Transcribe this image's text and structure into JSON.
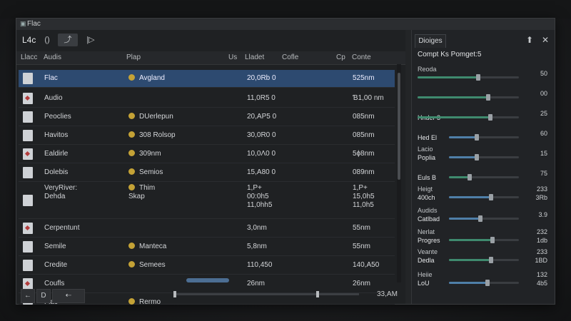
{
  "window": {
    "title": "Flac"
  },
  "toolbar": {
    "label": "L4c",
    "icon1": "()",
    "icon2": "⤴",
    "icon3": "|▷"
  },
  "columns": [
    "Llacc",
    "Audis",
    "Plap",
    "Us",
    "Lladet",
    "Cofle",
    "Cp",
    "Conte"
  ],
  "rows": [
    {
      "name": "Flac",
      "mid": "Avgland",
      "c3": "20,0Rb 0",
      "c5": "525nm",
      "selected": true
    },
    {
      "name": "Audio",
      "mid": "",
      "c3": "11,0R5 0",
      "c5": "Ɓ1,00 nm",
      "selected": false
    },
    {
      "name": "Peoclies",
      "mid": "DUerlepun",
      "c3": "20,ΑP5 0",
      "c5": "085nm",
      "selected": false
    },
    {
      "name": "Havitos",
      "mid": "308 Rolsop",
      "c3": "30,0R0 0",
      "c5": "085nm",
      "selected": false
    },
    {
      "name": "Ealdirle",
      "mid": "309nm",
      "c3": "10,0Λ0 0",
      "c5": "5ɸ8nm",
      "selected": false
    },
    {
      "name": "Dolebis",
      "mid": "Semios",
      "c3": "15,Α80 0",
      "c5": "089nm",
      "selected": false
    },
    {
      "name": "VeryRiver:\nDehda",
      "mid": "Thim\nSkap",
      "c3": "1,P+\n00:0h5\n11,0hh5",
      "c5": "1,P+\n15,0h5\n11,0h5",
      "selected": false
    },
    {
      "name": "Cerpentunt",
      "mid": "",
      "c3": "3,0nm",
      "c5": "55nm",
      "selected": false
    },
    {
      "name": "Semile",
      "mid": "Manteca",
      "c3": "5,8nm",
      "c5": "55nm",
      "selected": false
    },
    {
      "name": "Credite",
      "mid": "Semees",
      "c3": "110,450",
      "c5": "140,Α50",
      "selected": false
    },
    {
      "name": "Coufls",
      "mid": "",
      "c3": "26nm",
      "c5": "26nm",
      "selected": false
    },
    {
      "name": "Flac",
      "mid": "Rermo",
      "c3": "",
      "c5": "",
      "selected": false
    }
  ],
  "statusbar": {
    "b1": "←",
    "b2": "D",
    "b3": "⇠",
    "time": "33,AM"
  },
  "side": {
    "tab": "Dioiges",
    "pin_icon": "⬆",
    "close_icon": "✕",
    "title": "Compt Ks Pomget:5",
    "sliders": [
      {
        "l1": "Reoda",
        "l2": "",
        "val": "50",
        "fill": 0.6,
        "color": "green"
      },
      {
        "l1": "",
        "l2": "",
        "val": "00",
        "fill": 0.7,
        "color": "green"
      },
      {
        "l1": "",
        "l2": "Hnder 3",
        "val": "25",
        "fill": 0.72,
        "color": "green"
      },
      {
        "l1": "",
        "l2": "Hed El",
        "val": "60",
        "fill": 0.4,
        "color": "blue"
      },
      {
        "l1": "Lacio",
        "l2": "Poplia",
        "val": "15",
        "fill": 0.4,
        "color": "blue"
      },
      {
        "l1": "",
        "l2": "Euls B",
        "val": "75",
        "fill": 0.3,
        "color": "green"
      },
      {
        "l1": "Heigt",
        "l2": "400ch",
        "v1": "233",
        "v2": "3Rb",
        "fill": 0.6,
        "color": "blue"
      },
      {
        "l1": "Audids",
        "l2": "Catlbad",
        "val": "3.9",
        "fill": 0.45,
        "color": "blue"
      },
      {
        "l1": "Nerlat",
        "l2": "Progres",
        "v1": "232",
        "v2": "1db",
        "fill": 0.62,
        "color": "green"
      },
      {
        "l1": "Veante",
        "l2": "Dedla",
        "v1": "233",
        "v2": "1BD",
        "fill": 0.6,
        "color": "green"
      },
      {
        "l1": "Heiie",
        "l2": "LoU",
        "v1": "132",
        "v2": "4b5",
        "fill": 0.55,
        "color": "blue"
      }
    ]
  }
}
